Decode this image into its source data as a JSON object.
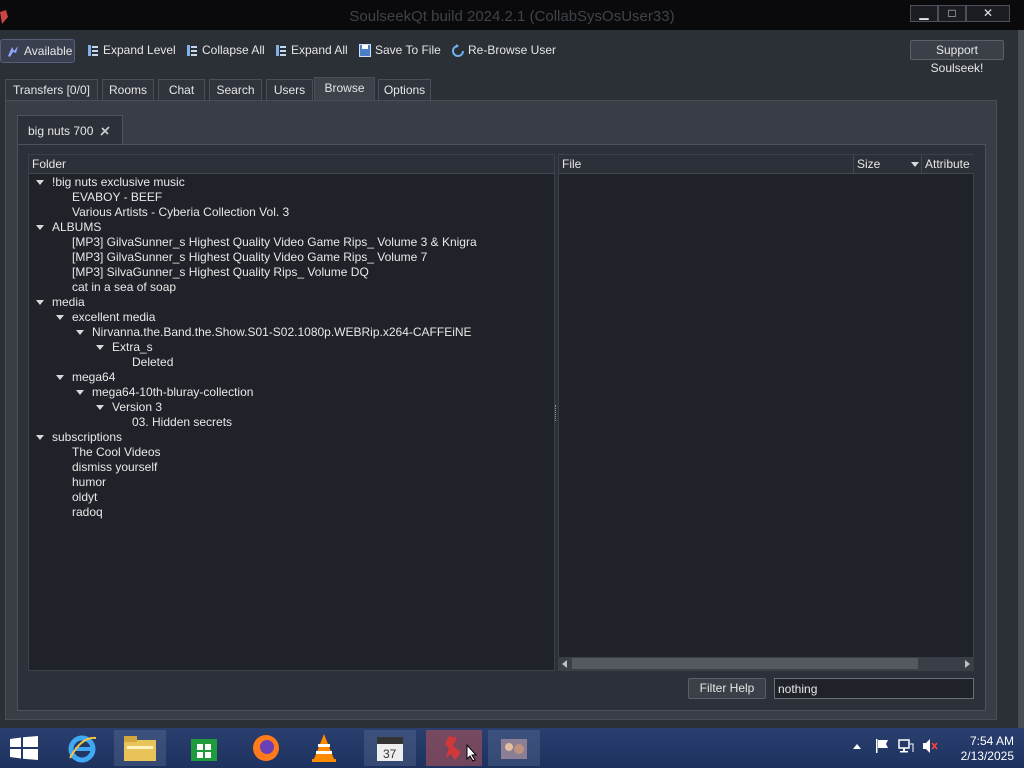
{
  "window": {
    "title": "SoulseekQt build 2024.2.1 (CollabSysOsUser33)",
    "minimize": "▁",
    "maximize": "□",
    "close": "✕"
  },
  "toolbar": {
    "available": "Available",
    "expand_level": "Expand Level",
    "collapse_all": "Collapse All",
    "expand_all": "Expand All",
    "save_to_file": "Save To File",
    "rebrowse": "Re-Browse User",
    "support": "Support Soulseek!"
  },
  "tabs": [
    "Transfers [0/0]",
    "Rooms",
    "Chat",
    "Search",
    "Users",
    "Browse",
    "Options"
  ],
  "active_tab": "Browse",
  "browse_tab": {
    "label": "big nuts 700"
  },
  "tree": {
    "header": "Folder",
    "rows": [
      {
        "label": "!big nuts exclusive music",
        "depth": 0,
        "expanded": true
      },
      {
        "label": "EVABOY - BEEF",
        "depth": 1,
        "expanded": false
      },
      {
        "label": "Various Artists - Cyberia Collection Vol. 3",
        "depth": 1,
        "expanded": false
      },
      {
        "label": "ALBUMS",
        "depth": 0,
        "expanded": true
      },
      {
        "label": "[MP3] GilvaSunner_s Highest Quality Video Game Rips_ Volume 3 & Knigra",
        "depth": 1,
        "expanded": false
      },
      {
        "label": "[MP3] GilvaSunner_s Highest Quality Video Game Rips_ Volume 7",
        "depth": 1,
        "expanded": false
      },
      {
        "label": "[MP3] SilvaGunner_s Highest Quality Rips_ Volume DQ",
        "depth": 1,
        "expanded": false
      },
      {
        "label": "cat in a sea of soap",
        "depth": 1,
        "expanded": false
      },
      {
        "label": "media",
        "depth": 0,
        "expanded": true
      },
      {
        "label": "excellent media",
        "depth": 1,
        "expanded": true
      },
      {
        "label": "Nirvanna.the.Band.the.Show.S01-S02.1080p.WEBRip.x264-CAFFEiNE",
        "depth": 2,
        "expanded": true
      },
      {
        "label": "Extra_s",
        "depth": 3,
        "expanded": true
      },
      {
        "label": "Deleted",
        "depth": 4,
        "expanded": false
      },
      {
        "label": "mega64",
        "depth": 1,
        "expanded": true
      },
      {
        "label": "mega64-10th-bluray-collection",
        "depth": 2,
        "expanded": true
      },
      {
        "label": "Version 3",
        "depth": 3,
        "expanded": true
      },
      {
        "label": "03. Hidden secrets",
        "depth": 4,
        "expanded": false
      },
      {
        "label": "subscriptions",
        "depth": 0,
        "expanded": true
      },
      {
        "label": "The Cool Videos",
        "depth": 1,
        "expanded": false
      },
      {
        "label": "dismiss yourself",
        "depth": 1,
        "expanded": false
      },
      {
        "label": "humor",
        "depth": 1,
        "expanded": false
      },
      {
        "label": "oldyt",
        "depth": 1,
        "expanded": false
      },
      {
        "label": "radoq",
        "depth": 1,
        "expanded": false
      }
    ]
  },
  "files": {
    "columns": [
      "File",
      "Size",
      "Attribute"
    ]
  },
  "filter": {
    "help": "Filter Help",
    "value": "nothing"
  },
  "taskbar": {
    "apps": [
      "internet-explorer",
      "file-explorer",
      "store",
      "firefox",
      "vlc",
      "calendar-app",
      "soulseek",
      "photo-app"
    ],
    "time": "7:54 AM",
    "date": "2/13/2025"
  },
  "colors": {
    "background": "#2b2f36",
    "panel": "#1f2228",
    "taskbar": "#1e3260",
    "active_taskbar_item": "#a0505a"
  }
}
